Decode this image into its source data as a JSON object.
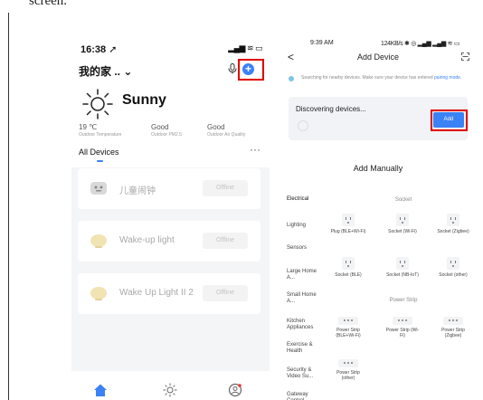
{
  "page": {
    "top_text": "screen."
  },
  "left": {
    "status": {
      "time": "16:38",
      "icons": "▂▄▆ ≋ ▭"
    },
    "header": {
      "home_title": "我的家 ..",
      "chevron": "⌄",
      "mic_icon": "mic-icon",
      "add_icon": "plus-circle-icon",
      "add_glyph": "+"
    },
    "weather": {
      "condition": "Sunny",
      "accent": "#3b82f6"
    },
    "stats": [
      {
        "value": "19 ℃",
        "label": "Outdoor Temperature"
      },
      {
        "value": "Good",
        "label": "Outdoor PM2.5"
      },
      {
        "value": "Good",
        "label": "Outdoor Air Quality"
      }
    ],
    "devices_header": {
      "title": "All Devices",
      "more": "···"
    },
    "devices": [
      {
        "name": "儿童闹钟",
        "status": "Offline",
        "icon": "clock-icon"
      },
      {
        "name": "Wake-up light",
        "status": "Offline",
        "icon": "lamp-icon"
      },
      {
        "name": "Wake Up Light II 2",
        "status": "Offline",
        "icon": "lamp-icon"
      }
    ],
    "tabbar": [
      {
        "icon": "home-icon",
        "color": "#3b82f6"
      },
      {
        "icon": "scene-sun-icon",
        "color": "#666666"
      },
      {
        "icon": "profile-icon",
        "color": "#666666"
      }
    ]
  },
  "right": {
    "status": {
      "time": "9:39 AM",
      "right": "124KB/s ✱ ◎ ▂▄▆ ▂▄▆ ≋ ▭"
    },
    "header": {
      "back": "<",
      "title": "Add Device",
      "scan_icon": "scan-icon"
    },
    "search_notice": {
      "text": "Searching for nearby devices. Make sure your device has entered ",
      "link": "pairing mode",
      "end": "."
    },
    "discover": {
      "title": "Discovering devices...",
      "add_label": "Add"
    },
    "manual_title": "Add Manually",
    "categories": [
      "Electrical",
      "Lighting",
      "Sensors",
      "Large Home A...",
      "Small Home A...",
      "Kitchen Appliances",
      "Exercise & Health",
      "Security & Video Su...",
      "Gateway Control"
    ],
    "sections": {
      "socket": "Socket",
      "power_strip": "Power Strip"
    },
    "socket_items": [
      "Plug (BLE+Wi-Fi)",
      "Socket (Wi-Fi)",
      "Socket (Zigbee)",
      "Socket (BLE)",
      "Socket (NB-IoT)",
      "Socket (other)"
    ],
    "strip_items": [
      "Power Strip (BLE+Wi-Fi)",
      "Power Strip (Wi-Fi)",
      "Power Strip (Zigbee)",
      "Power Strip (other)"
    ]
  }
}
